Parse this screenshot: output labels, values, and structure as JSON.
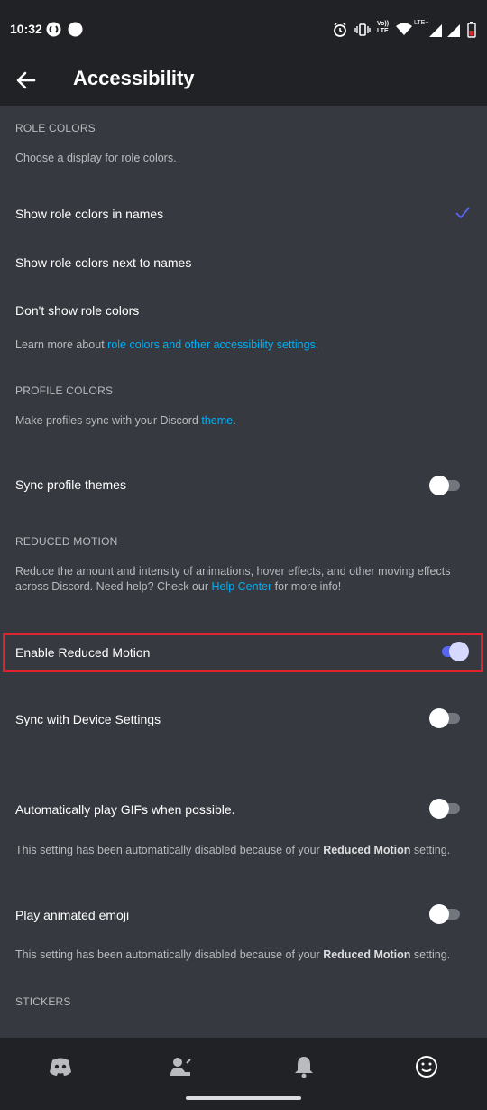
{
  "status_bar": {
    "time": "10:32",
    "network_label": "Vo)) LTE",
    "lte_label": "LTE+"
  },
  "header": {
    "title": "Accessibility"
  },
  "role_colors": {
    "header": "ROLE COLORS",
    "description": "Choose a display for role colors.",
    "options": [
      {
        "label": "Show role colors in names",
        "selected": true
      },
      {
        "label": "Show role colors next to names",
        "selected": false
      },
      {
        "label": "Don't show role colors",
        "selected": false
      }
    ],
    "learn_more_prefix": "Learn more about ",
    "learn_more_link": "role colors and other accessibility settings",
    "learn_more_suffix": "."
  },
  "profile_colors": {
    "header": "PROFILE COLORS",
    "description_prefix": "Make profiles sync with your Discord ",
    "description_link": "theme",
    "description_suffix": ".",
    "sync_label": "Sync profile themes",
    "sync_on": false
  },
  "reduced_motion": {
    "header": "REDUCED MOTION",
    "description_line1": "Reduce the amount and intensity of animations, hover effects, and other moving effects",
    "description_line2_prefix": "across Discord. Need help? Check our ",
    "description_link": "Help Center",
    "description_line2_suffix": " for more info!",
    "enable_label": "Enable Reduced Motion",
    "enable_on": true,
    "sync_device_label": "Sync with Device Settings",
    "sync_device_on": false
  },
  "gifs": {
    "label": "Automatically play GIFs when possible.",
    "on": false,
    "note_prefix": "This setting has been automatically disabled because of your ",
    "note_bold": "Reduced Motion",
    "note_suffix": " setting."
  },
  "emoji": {
    "label": "Play animated emoji",
    "on": false,
    "note_prefix": "This setting has been automatically disabled because of your ",
    "note_bold": "Reduced Motion",
    "note_suffix": " setting."
  },
  "stickers": {
    "header": "STICKERS"
  },
  "colors": {
    "accent": "#5865f2",
    "link": "#00aff4",
    "highlight": "#e0222a",
    "background": "#36393f",
    "header_bg": "#202225"
  },
  "bottom_nav": {
    "icons": [
      "discord-home-icon",
      "friends-icon",
      "notifications-bell-icon",
      "profile-smiley-icon"
    ]
  }
}
